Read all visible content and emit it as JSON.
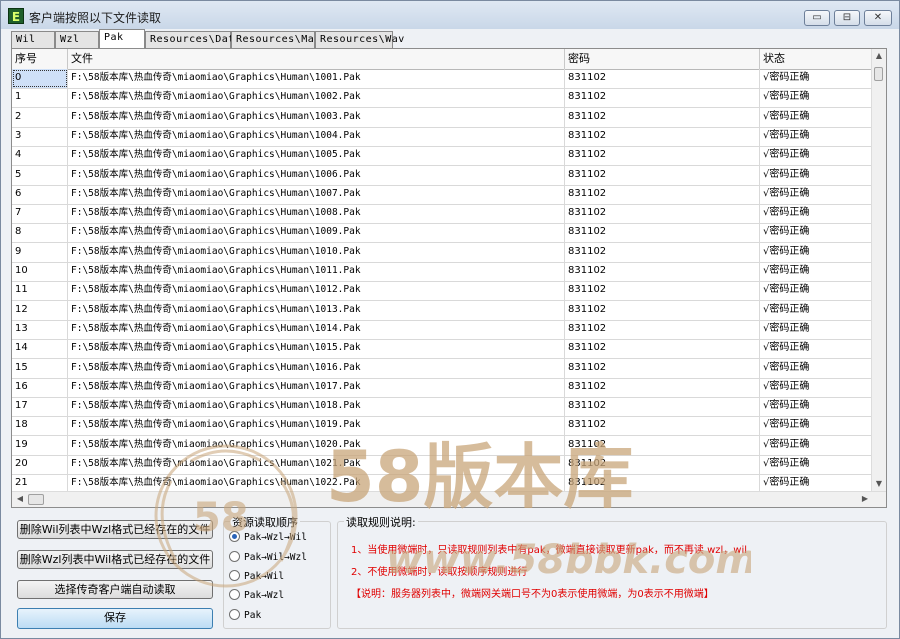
{
  "window": {
    "title": "客户端按照以下文件读取",
    "icon": "E"
  },
  "titlebar_buttons": {
    "minimize": "▭",
    "maximize": "⊟",
    "close": "✕"
  },
  "tabs": [
    {
      "label": "Wil",
      "active": false
    },
    {
      "label": "Wzl",
      "active": false
    },
    {
      "label": "Pak",
      "active": true
    },
    {
      "label": "Resources\\Data",
      "active": false
    },
    {
      "label": "Resources\\Map",
      "active": false
    },
    {
      "label": "Resources\\Wav",
      "active": false
    }
  ],
  "table": {
    "columns": [
      "序号",
      "文件",
      "密码",
      "状态"
    ],
    "rows": [
      [
        "0",
        "F:\\58版本库\\热血传奇\\miaomiao\\Graphics\\Human\\1001.Pak",
        "831102",
        "√密码正确"
      ],
      [
        "1",
        "F:\\58版本库\\热血传奇\\miaomiao\\Graphics\\Human\\1002.Pak",
        "831102",
        "√密码正确"
      ],
      [
        "2",
        "F:\\58版本库\\热血传奇\\miaomiao\\Graphics\\Human\\1003.Pak",
        "831102",
        "√密码正确"
      ],
      [
        "3",
        "F:\\58版本库\\热血传奇\\miaomiao\\Graphics\\Human\\1004.Pak",
        "831102",
        "√密码正确"
      ],
      [
        "4",
        "F:\\58版本库\\热血传奇\\miaomiao\\Graphics\\Human\\1005.Pak",
        "831102",
        "√密码正确"
      ],
      [
        "5",
        "F:\\58版本库\\热血传奇\\miaomiao\\Graphics\\Human\\1006.Pak",
        "831102",
        "√密码正确"
      ],
      [
        "6",
        "F:\\58版本库\\热血传奇\\miaomiao\\Graphics\\Human\\1007.Pak",
        "831102",
        "√密码正确"
      ],
      [
        "7",
        "F:\\58版本库\\热血传奇\\miaomiao\\Graphics\\Human\\1008.Pak",
        "831102",
        "√密码正确"
      ],
      [
        "8",
        "F:\\58版本库\\热血传奇\\miaomiao\\Graphics\\Human\\1009.Pak",
        "831102",
        "√密码正确"
      ],
      [
        "9",
        "F:\\58版本库\\热血传奇\\miaomiao\\Graphics\\Human\\1010.Pak",
        "831102",
        "√密码正确"
      ],
      [
        "10",
        "F:\\58版本库\\热血传奇\\miaomiao\\Graphics\\Human\\1011.Pak",
        "831102",
        "√密码正确"
      ],
      [
        "11",
        "F:\\58版本库\\热血传奇\\miaomiao\\Graphics\\Human\\1012.Pak",
        "831102",
        "√密码正确"
      ],
      [
        "12",
        "F:\\58版本库\\热血传奇\\miaomiao\\Graphics\\Human\\1013.Pak",
        "831102",
        "√密码正确"
      ],
      [
        "13",
        "F:\\58版本库\\热血传奇\\miaomiao\\Graphics\\Human\\1014.Pak",
        "831102",
        "√密码正确"
      ],
      [
        "14",
        "F:\\58版本库\\热血传奇\\miaomiao\\Graphics\\Human\\1015.Pak",
        "831102",
        "√密码正确"
      ],
      [
        "15",
        "F:\\58版本库\\热血传奇\\miaomiao\\Graphics\\Human\\1016.Pak",
        "831102",
        "√密码正确"
      ],
      [
        "16",
        "F:\\58版本库\\热血传奇\\miaomiao\\Graphics\\Human\\1017.Pak",
        "831102",
        "√密码正确"
      ],
      [
        "17",
        "F:\\58版本库\\热血传奇\\miaomiao\\Graphics\\Human\\1018.Pak",
        "831102",
        "√密码正确"
      ],
      [
        "18",
        "F:\\58版本库\\热血传奇\\miaomiao\\Graphics\\Human\\1019.Pak",
        "831102",
        "√密码正确"
      ],
      [
        "19",
        "F:\\58版本库\\热血传奇\\miaomiao\\Graphics\\Human\\1020.Pak",
        "831102",
        "√密码正确"
      ],
      [
        "20",
        "F:\\58版本库\\热血传奇\\miaomiao\\Graphics\\Human\\1021.Pak",
        "831102",
        "√密码正确"
      ],
      [
        "21",
        "F:\\58版本库\\热血传奇\\miaomiao\\Graphics\\Human\\1022.Pak",
        "831102",
        "√密码正确"
      ]
    ]
  },
  "buttons": {
    "delete_wil": "删除Wil列表中Wzl格式已经存在的文件",
    "delete_wzl": "删除Wzl列表中Wil格式已经存在的文件",
    "select_client": "选择传奇客户端自动读取",
    "save": "保存"
  },
  "order_group": {
    "title": "资源读取顺序",
    "options": [
      "Pak→Wzl→Wil",
      "Pak→Wil→Wzl",
      "Pak→Wil",
      "Pak→Wzl",
      "Pak"
    ],
    "selected_index": 0
  },
  "rules_group": {
    "title": "读取规则说明:",
    "lines": [
      "1、当使用微端时，只读取规则列表中有pak，微端直接读取更新pak，而不再读 wzl，wil",
      "2、不使用微端时，读取按顺序规则进行",
      "【说明：服务器列表中，微端网关端口号不为0表示使用微端，为0表示不用微端】"
    ]
  },
  "watermark": {
    "brand": "58版本库",
    "url": "www.58bbk.com",
    "seal": "58"
  },
  "colors": {
    "rule_text": "#e00000",
    "watermark": "#c9a67a"
  }
}
